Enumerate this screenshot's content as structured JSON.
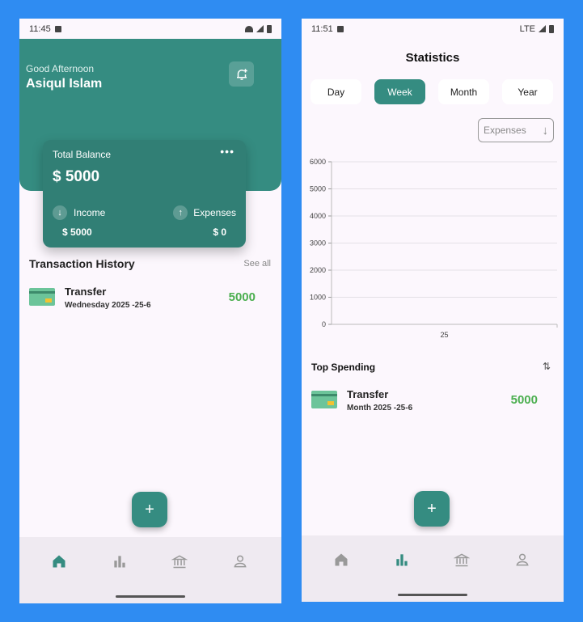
{
  "home": {
    "status_time": "11:45",
    "greeting": "Good Afternoon",
    "user_name": "Asiqul Islam",
    "balance": {
      "title": "Total Balance",
      "amount": "$ 5000",
      "income_label": "Income",
      "income_amount": "$ 5000",
      "expenses_label": "Expenses",
      "expenses_amount": "$ 0"
    },
    "history_title": "Transaction History",
    "see_all": "See all",
    "transactions": [
      {
        "name": "Transfer",
        "date": "Wednesday 2025 -25-6",
        "amount": "5000"
      }
    ],
    "fab_label": "+"
  },
  "stats": {
    "status_time": "11:51",
    "network": "LTE",
    "title": "Statistics",
    "periods": [
      "Day",
      "Week",
      "Month",
      "Year"
    ],
    "active_period": "Week",
    "filter_label": "Expenses",
    "top_spending_title": "Top Spending",
    "top_spending": [
      {
        "name": "Transfer",
        "date": "Month 2025 -25-6",
        "amount": "5000"
      }
    ],
    "fab_label": "+"
  },
  "nav_items": [
    "home-icon",
    "stats-icon",
    "bank-icon",
    "profile-icon"
  ],
  "colors": {
    "accent": "#358c81",
    "positive": "#4caf50",
    "background": "#2f8cf2"
  },
  "chart_data": {
    "type": "bar",
    "categories": [
      "25"
    ],
    "values": [
      0
    ],
    "ylim": [
      0,
      6000
    ],
    "yticks": [
      0,
      1000,
      2000,
      3000,
      4000,
      5000,
      6000
    ],
    "grid": true
  }
}
